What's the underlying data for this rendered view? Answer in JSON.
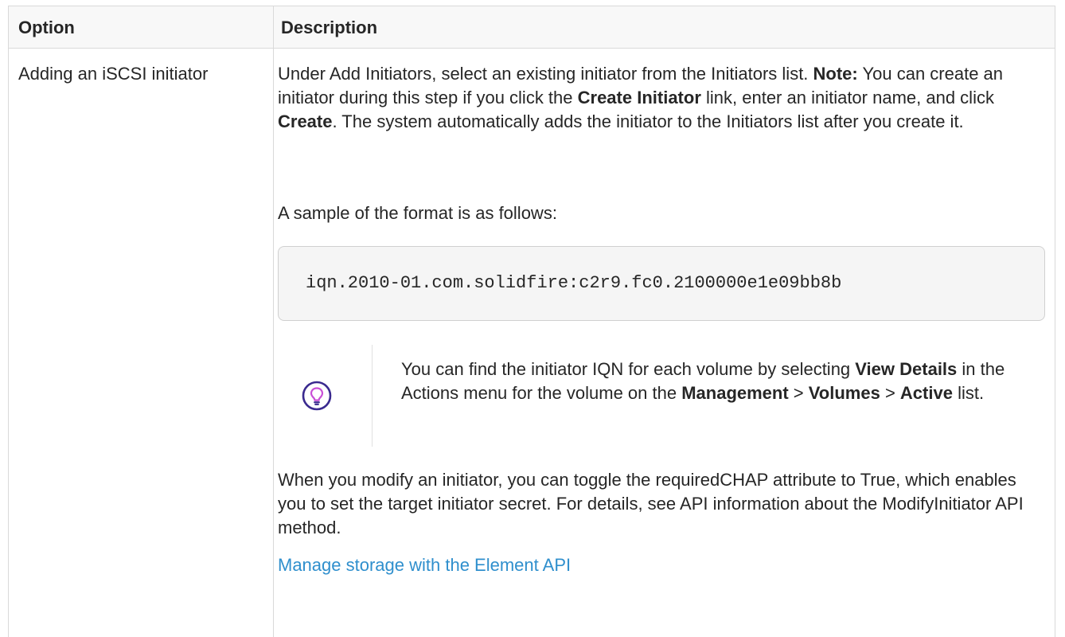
{
  "table": {
    "header": {
      "option": "Option",
      "description": "Description"
    },
    "row": {
      "option": "Adding an iSCSI initiator",
      "description": {
        "p1_a": "Under Add Initiators, select an existing initiator from the Initiators list. ",
        "p1_note": "Note:",
        "p1_b": " You can create an initiator during this step if you click the ",
        "p1_create_initiator": "Create Initiator",
        "p1_c": " link, enter an initiator name, and click ",
        "p1_create": "Create",
        "p1_d": ". The system automatically adds the initiator to the Initiators list after you create it.",
        "sample_intro": "A sample of the format is as follows:",
        "code_sample": "iqn.2010-01.com.solidfire:c2r9.fc0.2100000e1e09bb8b",
        "tip": {
          "icon": "lightbulb-icon",
          "t1": "You can find the initiator IQN for each volume by selecting ",
          "view_details": "View Details",
          "t2": " in the Actions menu for the volume on the ",
          "management": "Management",
          "t3": " > ",
          "volumes": "Volumes",
          "t4": " > ",
          "active": "Active",
          "t5": " list."
        },
        "modify_para": "When you modify an initiator, you can toggle the requiredCHAP attribute to True, which enables you to set the target initiator secret. For details, see API information about the ModifyInitiator API method.",
        "link_text": "Manage storage with the Element API"
      }
    }
  },
  "colors": {
    "text": "#262626",
    "link": "#2f8fcd",
    "header_bg": "#f8f8f8",
    "code_bg": "#f5f5f5",
    "tip_icon": "#3a2a8f",
    "border": "#d9d9d9"
  }
}
